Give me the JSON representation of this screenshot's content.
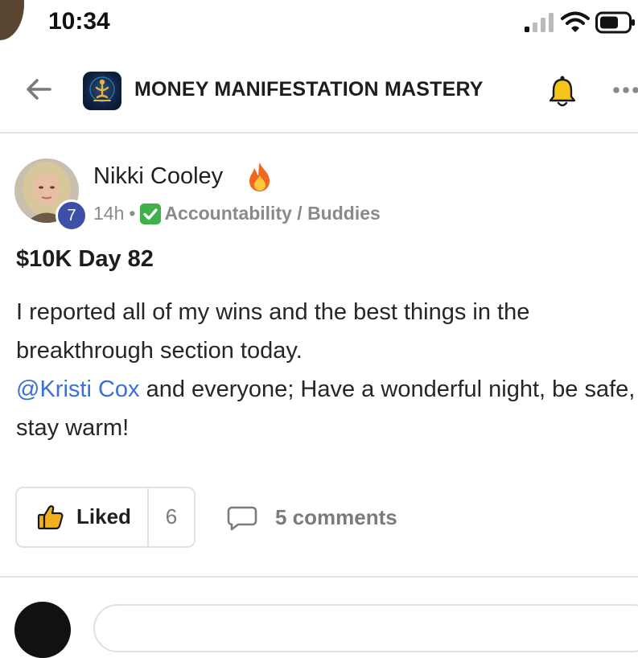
{
  "status_bar": {
    "time": "10:34"
  },
  "header": {
    "title": "MONEY MANIFESTATION MASTERY",
    "icons": [
      "back-arrow-icon",
      "group-logo",
      "bell-icon",
      "more-icon"
    ]
  },
  "post": {
    "author": "Nikki Cooley",
    "author_emoji_icon": "fire-icon",
    "level": "7",
    "time": "14h",
    "separator": "•",
    "category": "Accountability / Buddies",
    "category_icon": "green-check-icon",
    "title": "$10K Day 82",
    "body_line_1": "I reported all of my wins and the best things in the breakthrough section today.",
    "mention": "@Kristi Cox",
    "body_line_2_rest": " and everyone; Have a wonderful night, be safe, stay warm!",
    "like_label": "Liked",
    "like_count": "6",
    "comments_label": "5 comments"
  },
  "colors": {
    "mention": "#3d6fd8",
    "level_badge": "#3d4fa6",
    "check_green": "#3fb14a",
    "liked_thumb": "#f2b01e",
    "muted_text": "#8a8a8a"
  }
}
